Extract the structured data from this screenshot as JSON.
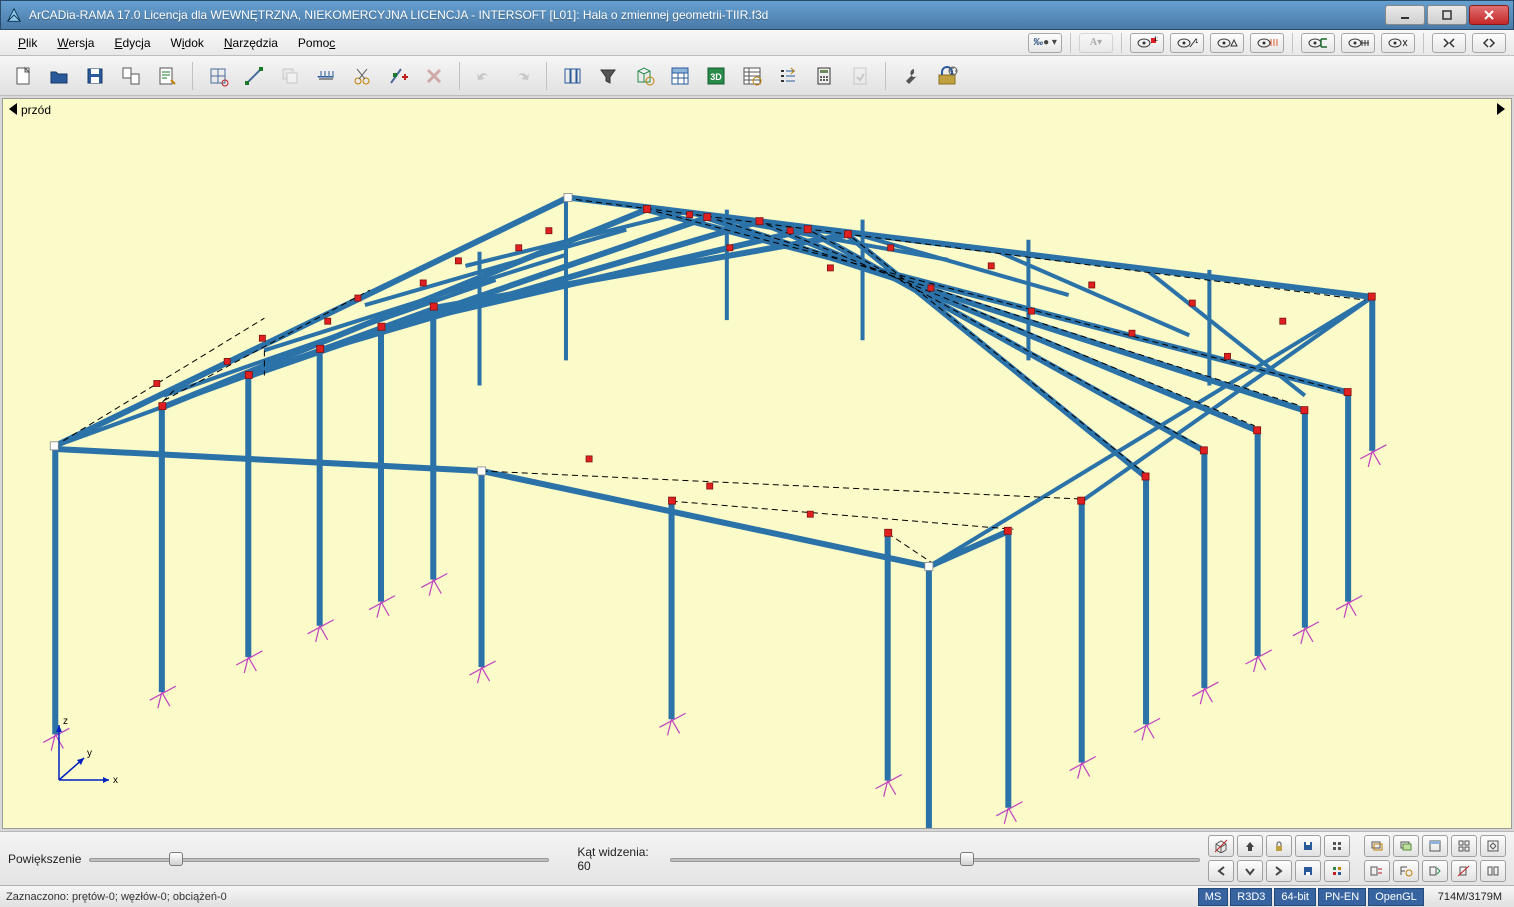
{
  "title": "ArCADia-RAMA 17.0 Licencja dla WEWNĘTRZNA, NIEKOMERCYJNA LICENCJA - INTERSOFT [L01]: Hala o zmiennej geometrii-TIIR.f3d",
  "menus": {
    "plik": "Plik",
    "wersja": "Wersja",
    "edycja": "Edycja",
    "widok": "Widok",
    "narzedzia": "Narzędzia",
    "pomoc": "Pomoc"
  },
  "view_label": "przód",
  "sliders": {
    "zoom_label": "Powiększenie",
    "fov_label": "Kąt widzenia: 60"
  },
  "status": {
    "selection": "Zaznaczono: prętów-0; węzłów-0; obciążeń-0",
    "badges": [
      "MS",
      "R3D3",
      "64-bit",
      "PN-EN",
      "OpenGL"
    ],
    "mem": "714M/3179M"
  },
  "axis": {
    "x": "x",
    "y": "y",
    "z": "z"
  }
}
